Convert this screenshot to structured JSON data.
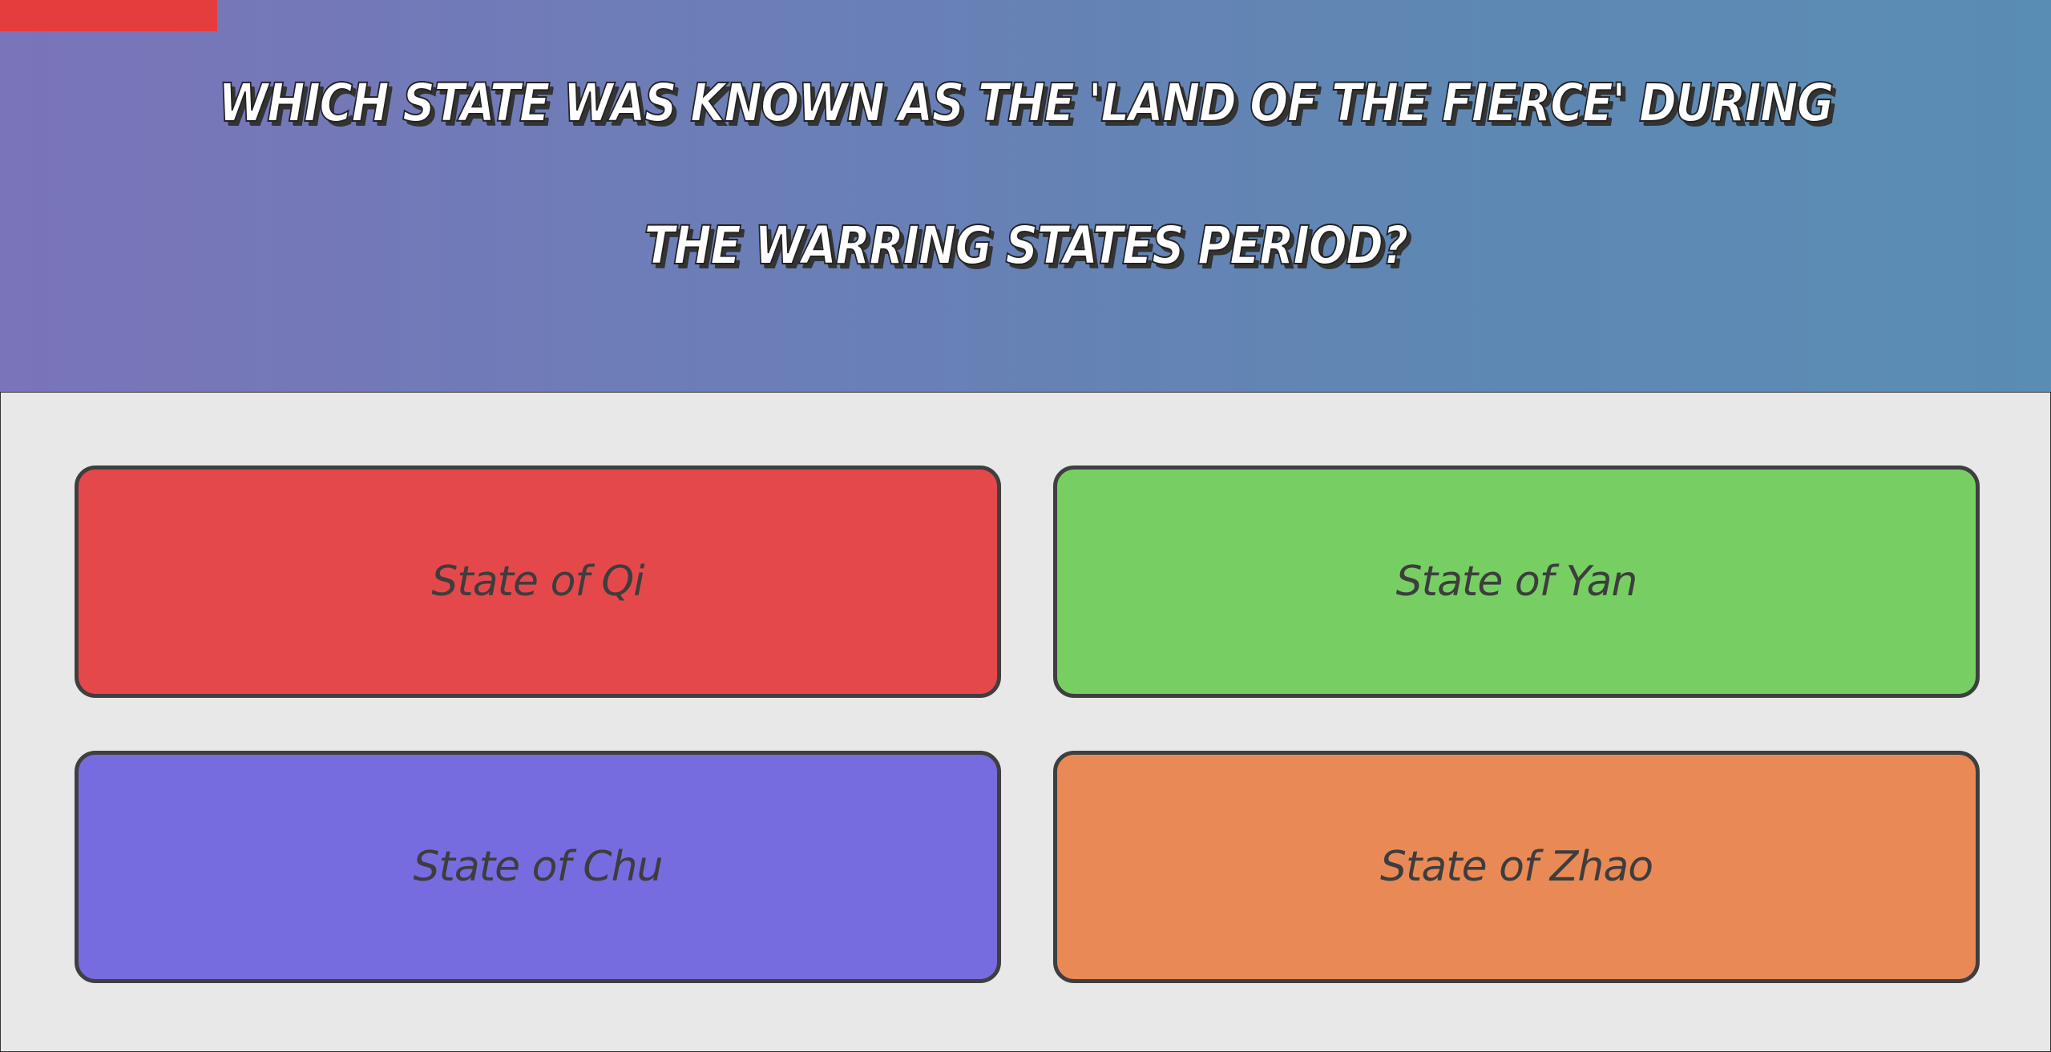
{
  "progress": {
    "fraction": 0.106,
    "color": "#e53c3e"
  },
  "question": {
    "text": "Which state was known as the 'Land of the Fierce' during the Warring States period?"
  },
  "answers": [
    {
      "label": "State of Qi",
      "color": "#e5484b"
    },
    {
      "label": "State of Yan",
      "color": "#77cf64"
    },
    {
      "label": "State of Chu",
      "color": "#766cdf"
    },
    {
      "label": "State of Zhao",
      "color": "#e98a56"
    }
  ],
  "colors": {
    "header_gradient_start": "#7a74ba",
    "header_gradient_end": "#5a8db3",
    "panel_background": "#e8e8e8"
  }
}
